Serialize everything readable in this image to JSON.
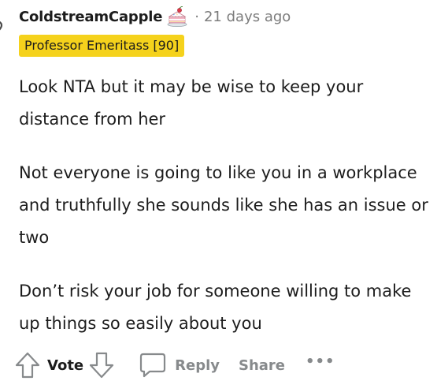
{
  "comment": {
    "author": "ColdstreamCapple",
    "separator": "·",
    "timestamp": "21 days ago",
    "flair": "Professor Emeritass [90]",
    "flair_color": "#f5d21c",
    "paragraphs": [
      "Look NTA but it may be wise to keep your distance from her",
      "Not everyone is going to like you in a workplace and truthfully she sounds like she has an issue or two",
      "Don’t risk your job for someone willing to make up things so easily about you"
    ]
  },
  "actions": {
    "upvote_icon": "arrow-up-icon",
    "vote_label": "Vote",
    "downvote_icon": "arrow-down-icon",
    "reply_icon": "speech-bubble-icon",
    "reply_label": "Reply",
    "share_label": "Share",
    "more_label": "•••"
  },
  "icons": {
    "author_badge": "cake-icon",
    "thread": "thread-line-icon"
  }
}
